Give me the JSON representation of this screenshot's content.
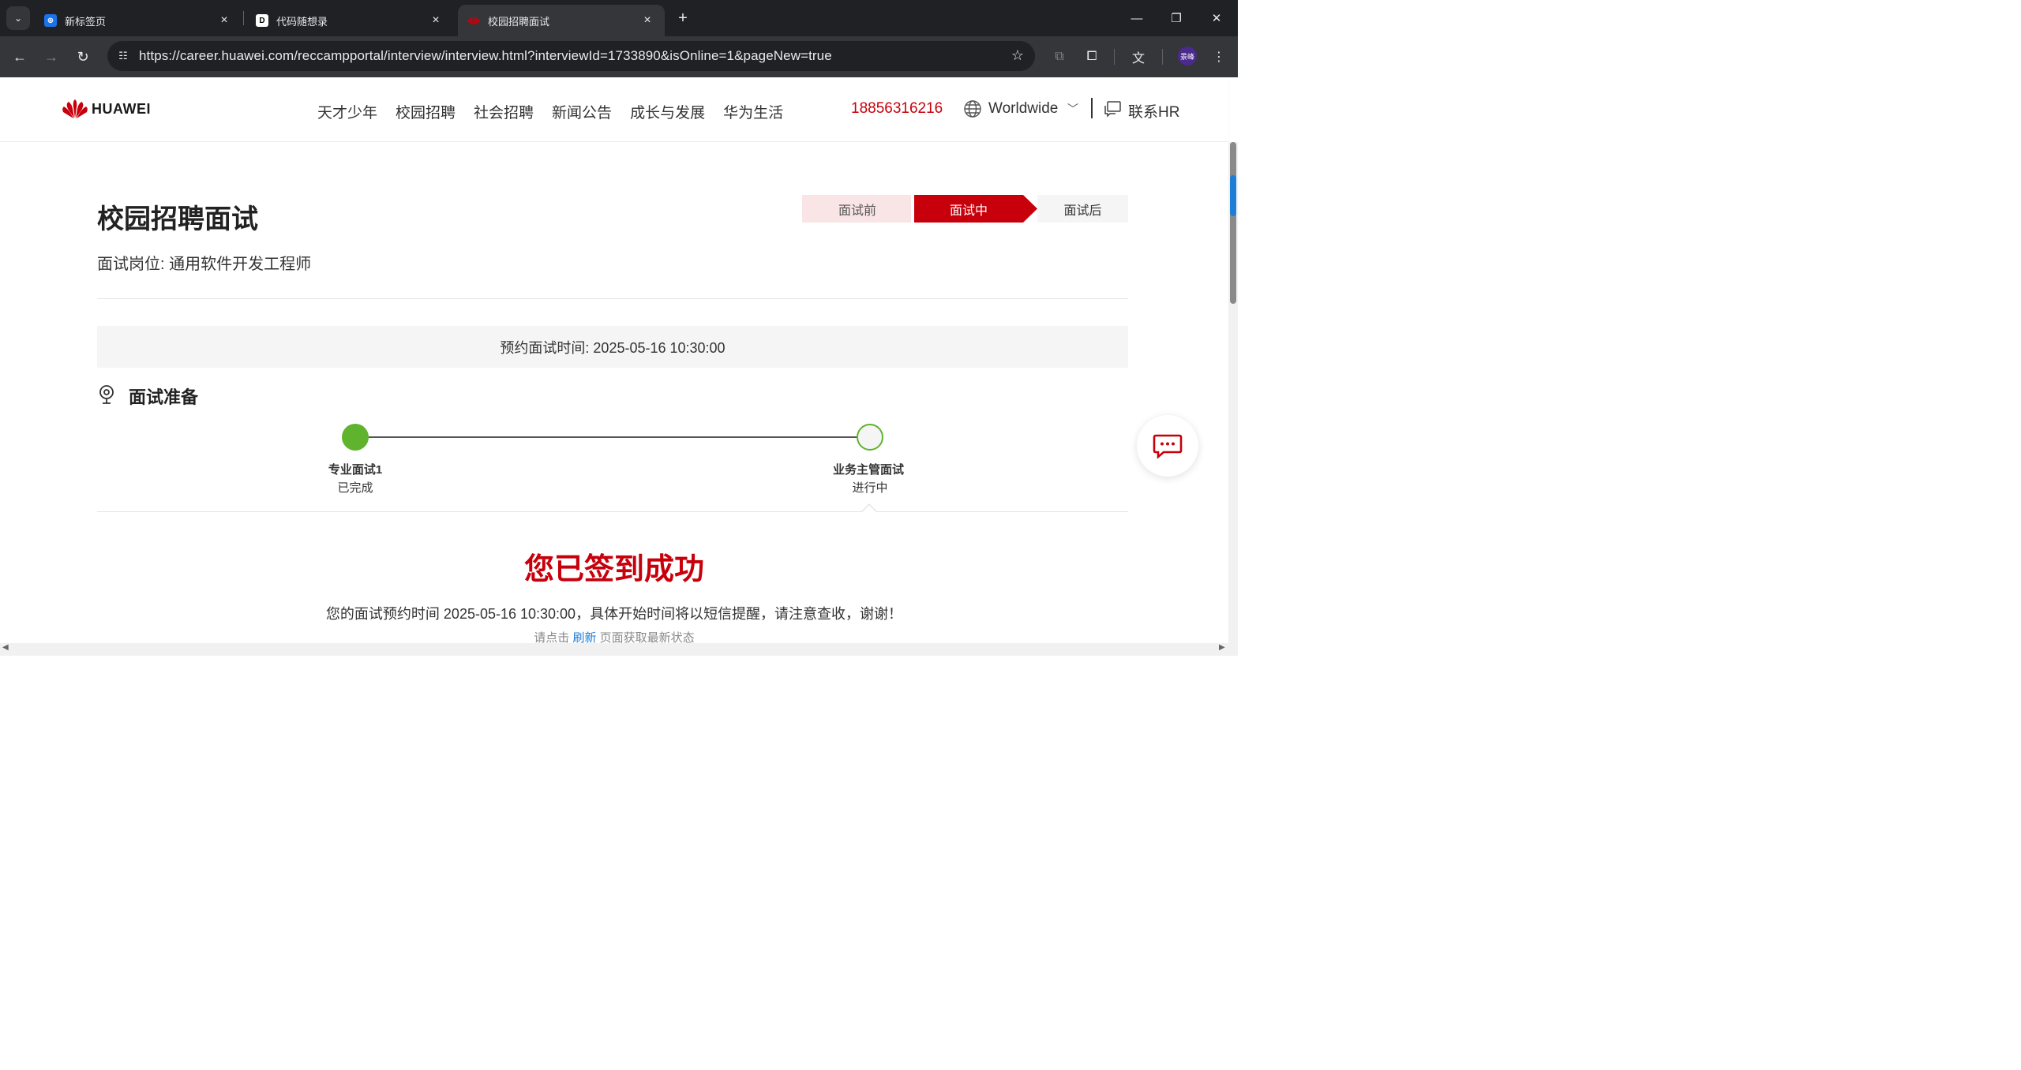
{
  "browser": {
    "tabs": [
      {
        "title": "新标签页",
        "active": false
      },
      {
        "title": "代码随想录",
        "active": false
      },
      {
        "title": "校园招聘面试",
        "active": true
      }
    ],
    "url": "https://career.huawei.com/reccampportal/interview/interview.html?interviewId=1733890&isOnline=1&pageNew=true",
    "profile_initials": "景峰"
  },
  "header": {
    "logo_text": "HUAWEI",
    "nav": [
      "天才少年",
      "校园招聘",
      "社会招聘",
      "新闻公告",
      "成长与发展",
      "华为生活"
    ],
    "phone": "18856316216",
    "region": "Worldwide",
    "contact": "联系HR"
  },
  "page": {
    "title": "校园招聘面试",
    "position_label": "面试岗位: 通用软件开发工程师",
    "steps": [
      "面试前",
      "面试中",
      "面试后"
    ],
    "schedule": "预约面试时间: 2025-05-16 10:30:00",
    "prep_title": "面试准备",
    "timeline": [
      {
        "title": "专业面试1",
        "status": "已完成"
      },
      {
        "title": "业务主管面试",
        "status": "进行中"
      }
    ],
    "success": "您已签到成功",
    "notice": "您的面试预约时间 2025-05-16 10:30:00，具体开始时间将以短信提醒，请注意查收，谢谢！",
    "refresh_prefix": "请点击",
    "refresh_link": "刷新",
    "refresh_suffix": "页面获取最新状态"
  },
  "colors": {
    "brand_red": "#c7000b",
    "done_green": "#5fb32d",
    "link_blue": "#1d7ed8"
  }
}
